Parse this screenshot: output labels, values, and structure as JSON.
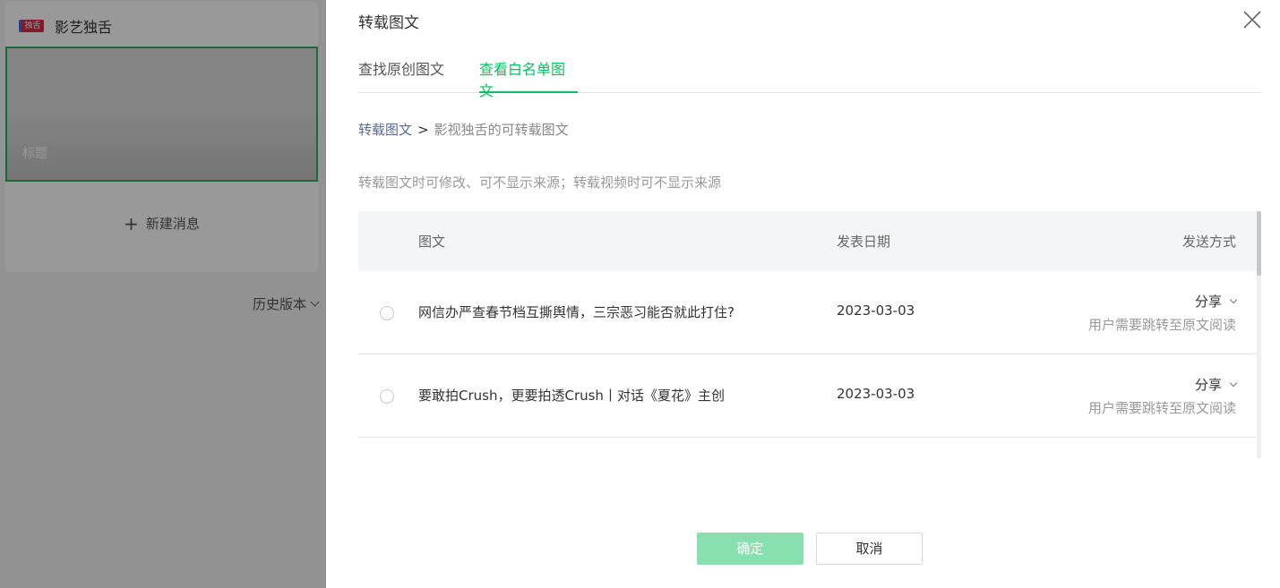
{
  "editor": {
    "account_name": "影艺独舌",
    "account_logo_text": "独舌",
    "cover_title_placeholder": "标题",
    "new_message_label": "新建消息",
    "history_label": "历史版本"
  },
  "dialog": {
    "title": "转载图文",
    "tabs": [
      {
        "label": "查找原创图文",
        "active": false
      },
      {
        "label": "查看白名单图文",
        "active": true
      }
    ],
    "breadcrumb": {
      "root": "转载图文",
      "separator": ">",
      "current": "影视独舌的可转载图文"
    },
    "notice": "转载图文时可修改、可不显示来源；转载视频时可不显示来源",
    "table": {
      "headers": {
        "title": "图文",
        "date": "发表日期",
        "method": "发送方式"
      },
      "rows": [
        {
          "title": "网信办严查春节档互撕舆情，三宗恶习能否就此打住?",
          "date": "2023-03-03",
          "method": "分享",
          "hint": "用户需要跳转至原文阅读",
          "selected": false
        },
        {
          "title": "要敢拍Crush，更要拍透Crush丨对话《夏花》主创",
          "date": "2023-03-03",
          "method": "分享",
          "hint": "用户需要跳转至原文阅读",
          "selected": false
        }
      ]
    },
    "buttons": {
      "confirm": "确定",
      "cancel": "取消"
    }
  },
  "colors": {
    "accent": "#07c160",
    "link": "#576b95",
    "confirm_disabled": "#88e0b1"
  }
}
